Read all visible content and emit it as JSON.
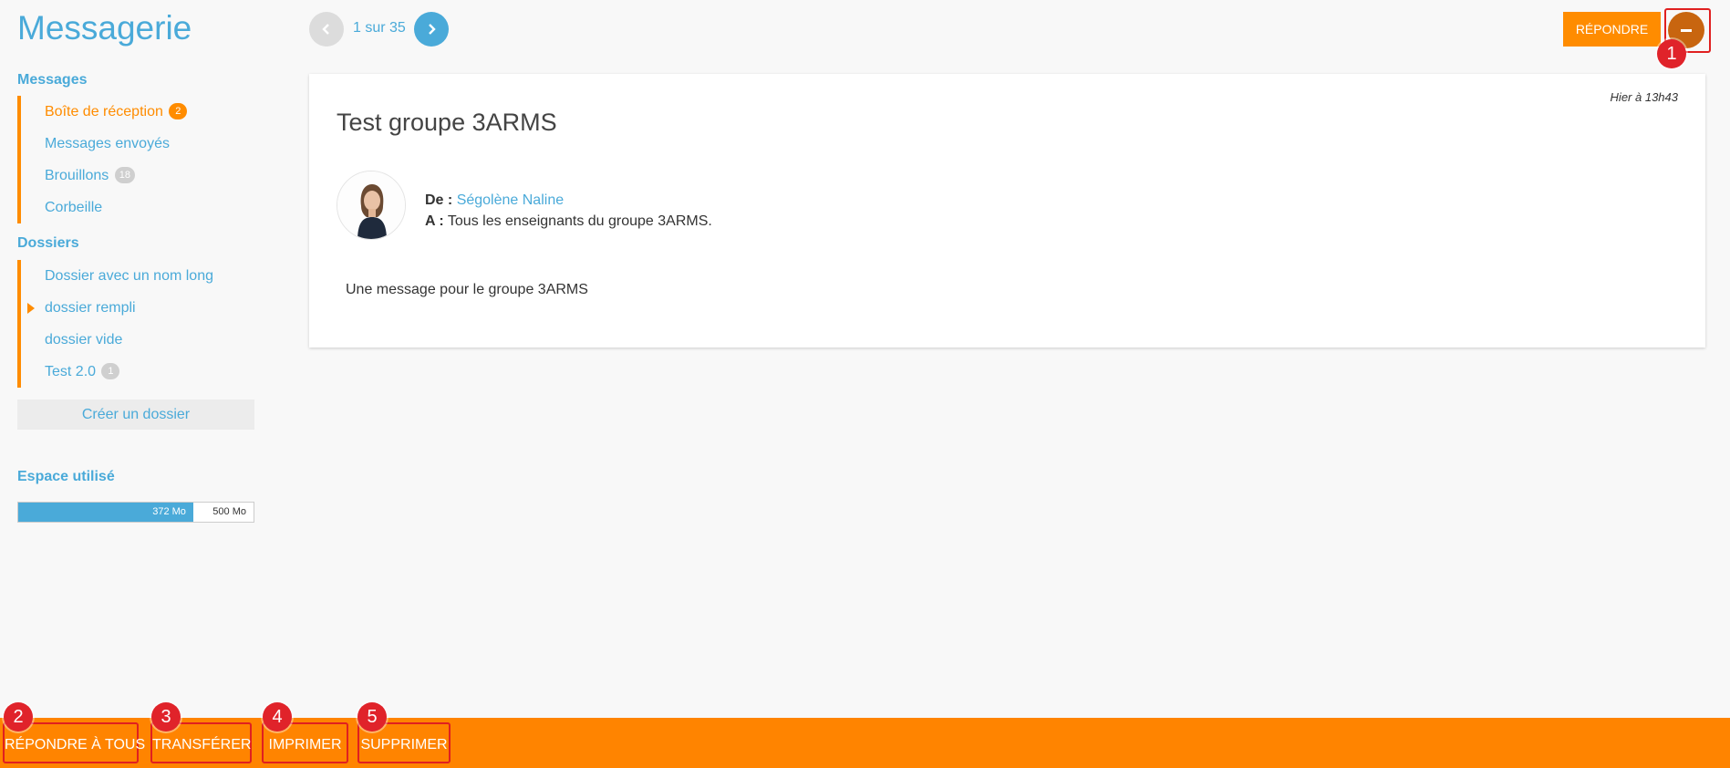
{
  "app": {
    "title": "Messagerie"
  },
  "sidebar": {
    "messages_title": "Messages",
    "messages": [
      {
        "label": "Boîte de réception",
        "badge": "2",
        "active": true
      },
      {
        "label": "Messages envoyés"
      },
      {
        "label": "Brouillons",
        "badge": "18"
      },
      {
        "label": "Corbeille"
      }
    ],
    "folders_title": "Dossiers",
    "folders": [
      {
        "label": "Dossier avec un nom long"
      },
      {
        "label": "dossier rempli",
        "expandable": true
      },
      {
        "label": "dossier vide"
      },
      {
        "label": "Test 2.0",
        "badge": "1"
      }
    ],
    "create_folder_label": "Créer un dossier",
    "storage": {
      "title": "Espace utilisé",
      "used_label": "372 Mo",
      "total_label": "500 Mo",
      "used_fraction": 0.744
    }
  },
  "pager": {
    "text": "1 sur 35"
  },
  "toolbar": {
    "reply_label": "RÉPONDRE"
  },
  "message": {
    "date": "Hier à 13h43",
    "subject": "Test groupe 3ARMS",
    "from_label": "De :",
    "from_name": "Ségolène Naline",
    "to_label": "A :",
    "to_value": "Tous les enseignants du groupe 3ARMS.",
    "body": "Une message pour le groupe 3ARMS"
  },
  "actions": {
    "reply_all": "RÉPONDRE À TOUS",
    "forward": "TRANSFÉRER",
    "print": "IMPRIMER",
    "delete": "SUPPRIMER"
  },
  "markers": [
    "1",
    "2",
    "3",
    "4",
    "5"
  ],
  "colors": {
    "accent_blue": "#4aaad9",
    "accent_orange": "#ff8c00",
    "marker_red": "#e0232a"
  }
}
